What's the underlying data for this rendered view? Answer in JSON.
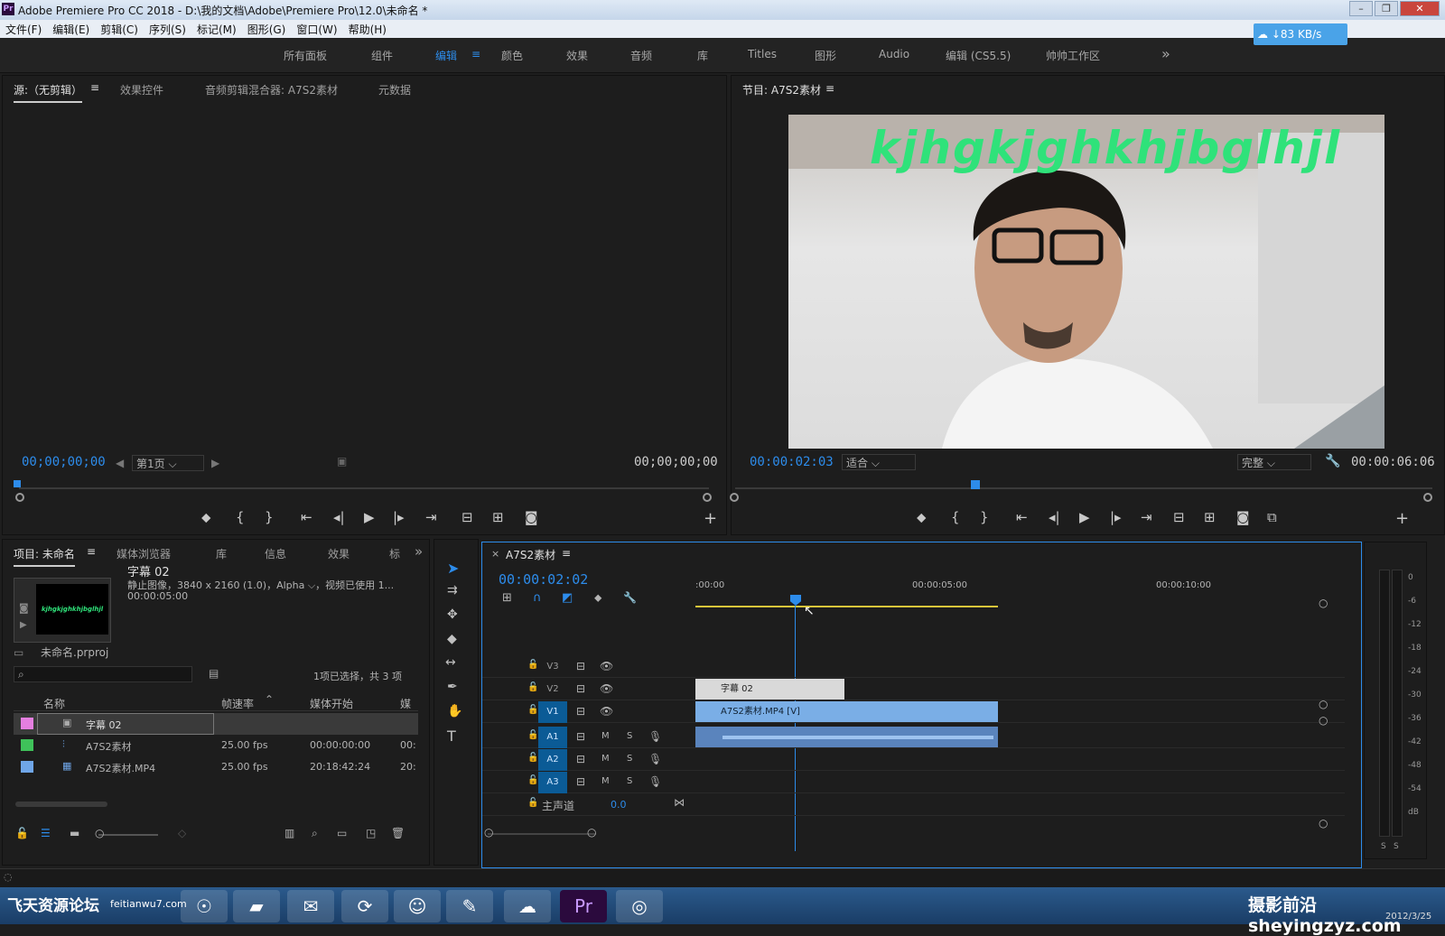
{
  "window": {
    "title": "Adobe Premiere Pro CC 2018 - D:\\我的文档\\Adobe\\Premiere Pro\\12.0\\未命名 *",
    "app_icon": "Pr"
  },
  "menu": [
    "文件(F)",
    "编辑(E)",
    "剪辑(C)",
    "序列(S)",
    "标记(M)",
    "图形(G)",
    "窗口(W)",
    "帮助(H)"
  ],
  "workspaces": {
    "items": [
      "所有面板",
      "组件",
      "编辑",
      "颜色",
      "效果",
      "音频",
      "库",
      "Titles",
      "图形",
      "Audio",
      "编辑 (CS5.5)",
      "帅帅工作区"
    ],
    "active": "编辑",
    "more": "»"
  },
  "network": {
    "speed": "↓83 KB/s"
  },
  "source": {
    "tabs": [
      "源:（无剪辑）",
      "效果控件",
      "音频剪辑混合器: A7S2素材",
      "元数据"
    ],
    "timecode_left": "00;00;00;00",
    "page": "第1页",
    "timecode_right": "00;00;00;00"
  },
  "program": {
    "tab": "节目: A7S2素材",
    "timecode": "00:00:02:03",
    "fit": "适合",
    "quality": "完整",
    "duration": "00:00:06:06",
    "caption": "kjhgkjghkhjbglhjl"
  },
  "project": {
    "tabs": [
      "项目: 未命名",
      "媒体浏览器",
      "库",
      "信息",
      "效果",
      "标"
    ],
    "preview": {
      "name": "字幕 02",
      "desc": "静止图像，3840 x 2160 (1.0)，Alpha ⌵，视频已使用 1...",
      "duration": "00:00:05:00",
      "thumb_text": "kjhgkjghkhjbglhjl"
    },
    "file": "未命名.prproj",
    "search_placeholder": "",
    "selection": "1项已选择，共 3 项",
    "columns": [
      "名称",
      "帧速率",
      "媒体开始",
      "媒"
    ],
    "rows": [
      {
        "color": "#e57fe0",
        "name": "字幕 02",
        "fps": "",
        "start": "",
        "extra": ""
      },
      {
        "color": "#3fc25a",
        "name": "A7S2素材",
        "fps": "25.00 fps",
        "start": "00:00:00:00",
        "extra": "00:"
      },
      {
        "color": "#6fa6e8",
        "name": "A7S2素材.MP4",
        "fps": "25.00 fps",
        "start": "20:18:42:24",
        "extra": "20:"
      }
    ]
  },
  "timeline": {
    "tab": "A7S2素材",
    "timecode": "00:00:02:02",
    "ruler": [
      ":00:00",
      "00:00:05:00",
      "00:00:10:00"
    ],
    "video_tracks": [
      "V3",
      "V2",
      "V1"
    ],
    "audio_tracks": [
      "A1",
      "A2",
      "A3"
    ],
    "master": {
      "label": "主声道",
      "value": "0.0"
    },
    "clips": {
      "title": "字幕 02",
      "video": "A7S2素材.MP4 [V]"
    },
    "ms": [
      "M",
      "S"
    ]
  },
  "meter": {
    "labels": [
      "0",
      "-6",
      "-12",
      "-18",
      "-24",
      "-30",
      "-36",
      "-42",
      "-48",
      "-54",
      "dB"
    ],
    "solo": [
      "S",
      "S"
    ]
  },
  "watermark": {
    "left": "飞天资源论坛",
    "site": "feitianwu7.com",
    "right": "摄影前沿 sheyingzyz.com",
    "date": "2012/3/25"
  },
  "taskbar": [
    "☉",
    "✉",
    "⟳",
    "☺",
    "✎",
    "☁",
    "Pr",
    "◎"
  ]
}
